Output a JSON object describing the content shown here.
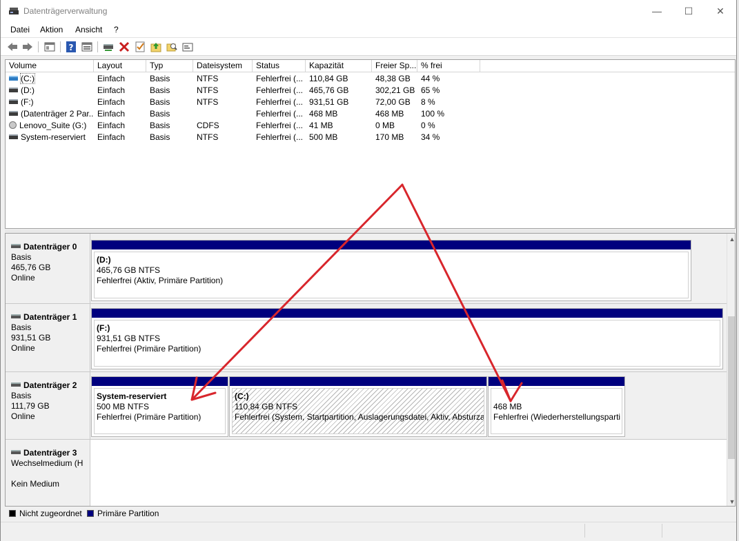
{
  "window": {
    "title": "Datenträgerverwaltung",
    "minimize": "—",
    "maximize": "☐",
    "close": "✕"
  },
  "menu": [
    "Datei",
    "Aktion",
    "Ansicht",
    "?"
  ],
  "toolbar_icons": [
    "back-icon",
    "forward-icon",
    "console-icon",
    "help-icon",
    "properties-icon",
    "connect-icon",
    "delete-icon",
    "check-icon",
    "folder-up-icon",
    "search-folder-icon",
    "window-icon"
  ],
  "volume_table": {
    "headers": [
      "Volume",
      "Layout",
      "Typ",
      "Dateisystem",
      "Status",
      "Kapazität",
      "Freier Sp...",
      "% frei"
    ],
    "rows": [
      {
        "volume": "(C:)",
        "layout": "Einfach",
        "typ": "Basis",
        "fs": "NTFS",
        "status": "Fehlerfrei (...",
        "cap": "110,84 GB",
        "free": "48,38 GB",
        "pct": "44 %",
        "icon": "primary"
      },
      {
        "volume": "(D:)",
        "layout": "Einfach",
        "typ": "Basis",
        "fs": "NTFS",
        "status": "Fehlerfrei (...",
        "cap": "465,76 GB",
        "free": "302,21 GB",
        "pct": "65 %",
        "icon": "drive"
      },
      {
        "volume": "(F:)",
        "layout": "Einfach",
        "typ": "Basis",
        "fs": "NTFS",
        "status": "Fehlerfrei (...",
        "cap": "931,51 GB",
        "free": "72,00 GB",
        "pct": "8 %",
        "icon": "drive"
      },
      {
        "volume": "(Datenträger 2 Par...",
        "layout": "Einfach",
        "typ": "Basis",
        "fs": "",
        "status": "Fehlerfrei (...",
        "cap": "468 MB",
        "free": "468 MB",
        "pct": "100 %",
        "icon": "drive"
      },
      {
        "volume": "Lenovo_Suite (G:)",
        "layout": "Einfach",
        "typ": "Basis",
        "fs": "CDFS",
        "status": "Fehlerfrei (...",
        "cap": "41 MB",
        "free": "0 MB",
        "pct": "0 %",
        "icon": "cd"
      },
      {
        "volume": "System-reserviert",
        "layout": "Einfach",
        "typ": "Basis",
        "fs": "NTFS",
        "status": "Fehlerfrei (...",
        "cap": "500 MB",
        "free": "170 MB",
        "pct": "34 %",
        "icon": "drive"
      }
    ]
  },
  "disks": [
    {
      "name": "Datenträger 0",
      "type": "Basis",
      "size": "465,76 GB",
      "state": "Online",
      "partitions": [
        {
          "name": "(D:)",
          "size": "465,76 GB NTFS",
          "status": "Fehlerfrei (Aktiv, Primäre Partition)"
        }
      ]
    },
    {
      "name": "Datenträger 1",
      "type": "Basis",
      "size": "931,51 GB",
      "state": "Online",
      "partitions": [
        {
          "name": "(F:)",
          "size": "931,51 GB NTFS",
          "status": "Fehlerfrei (Primäre Partition)"
        }
      ]
    },
    {
      "name": "Datenträger 2",
      "type": "Basis",
      "size": "111,79 GB",
      "state": "Online",
      "partitions": [
        {
          "name": "System-reserviert",
          "size": "500 MB NTFS",
          "status": "Fehlerfrei (Primäre Partition)"
        },
        {
          "name": "(C:)",
          "size": "110,84 GB NTFS",
          "status": "Fehlerfrei (System, Startpartition, Auslagerungsdatei, Aktiv, Absturza"
        },
        {
          "name": "",
          "size": "468 MB",
          "status": "Fehlerfrei (Wiederherstellungsparti"
        }
      ]
    },
    {
      "name": "Datenträger 3",
      "type": "Wechselmedium (H",
      "size": "",
      "state": "Kein Medium",
      "partitions": []
    }
  ],
  "legend": [
    {
      "label": "Nicht zugeordnet",
      "color": "#000000"
    },
    {
      "label": "Primäre Partition",
      "color": "#00007e"
    }
  ],
  "annotation_color": "#d8262c"
}
